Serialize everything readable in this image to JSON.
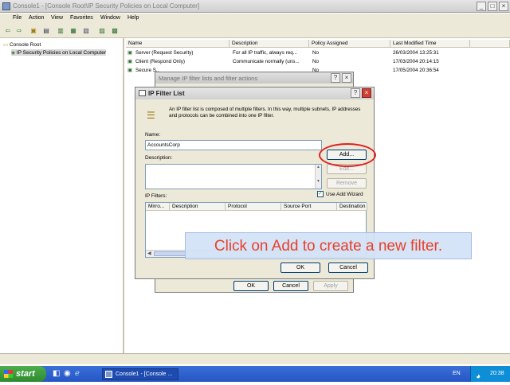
{
  "window": {
    "title": "Console1 - [Console Root\\IP Security Policies on Local Computer]",
    "controls": [
      "_",
      "□",
      "×"
    ]
  },
  "menu": [
    "File",
    "Action",
    "View",
    "Favorites",
    "Window",
    "Help"
  ],
  "tree": {
    "root": "Console Root",
    "child": "IP Security Policies on Local Computer"
  },
  "list": {
    "columns": [
      "Name",
      "Description",
      "Policy Assigned",
      "Last Modified Time"
    ],
    "rows": [
      {
        "name": "Server (Request Security)",
        "description": "For all IP traffic, always req...",
        "assigned": "No",
        "modified": "26/03/2004 13:25:31"
      },
      {
        "name": "Client (Respond Only)",
        "description": "Communicate normally (uns...",
        "assigned": "No",
        "modified": "17/03/2004 20:14:15"
      },
      {
        "name": "Secure S...",
        "description": "",
        "assigned": "No",
        "modified": "17/05/2004 20:36:54"
      }
    ]
  },
  "back_dialog": {
    "title": "Manage IP filter lists and filter actions",
    "ok_label": "OK",
    "cancel_label": "Cancel",
    "apply_label": "Apply"
  },
  "dialog": {
    "title": "IP Filter List",
    "intro": "An IP filter list is composed of multiple filters. In this way, multiple subnets, IP addresses and protocols can be combined into one IP filter.",
    "name_label": "Name:",
    "name_value": "AccountsCorp",
    "description_label": "Description:",
    "add_label": "Add...",
    "edit_label": "Edit...",
    "remove_label": "Remove",
    "filters_label": "IP Filters:",
    "wizard_label": "Use Add Wizard",
    "wizard_checked": true,
    "filter_columns": [
      "Mirro...",
      "Description",
      "Protocol",
      "Source Port",
      "Destination"
    ],
    "ok_label": "OK",
    "cancel_label": "Cancel"
  },
  "callout": "Click on Add to create a new filter.",
  "taskbar": {
    "start_label": "start",
    "task_label": "Console1 - [Console ...",
    "language": "EN",
    "clock": "20:38"
  },
  "colors": {
    "callout_text": "#e8402a",
    "highlight": "#e02020",
    "dialog_active_title": "#0a246a"
  }
}
